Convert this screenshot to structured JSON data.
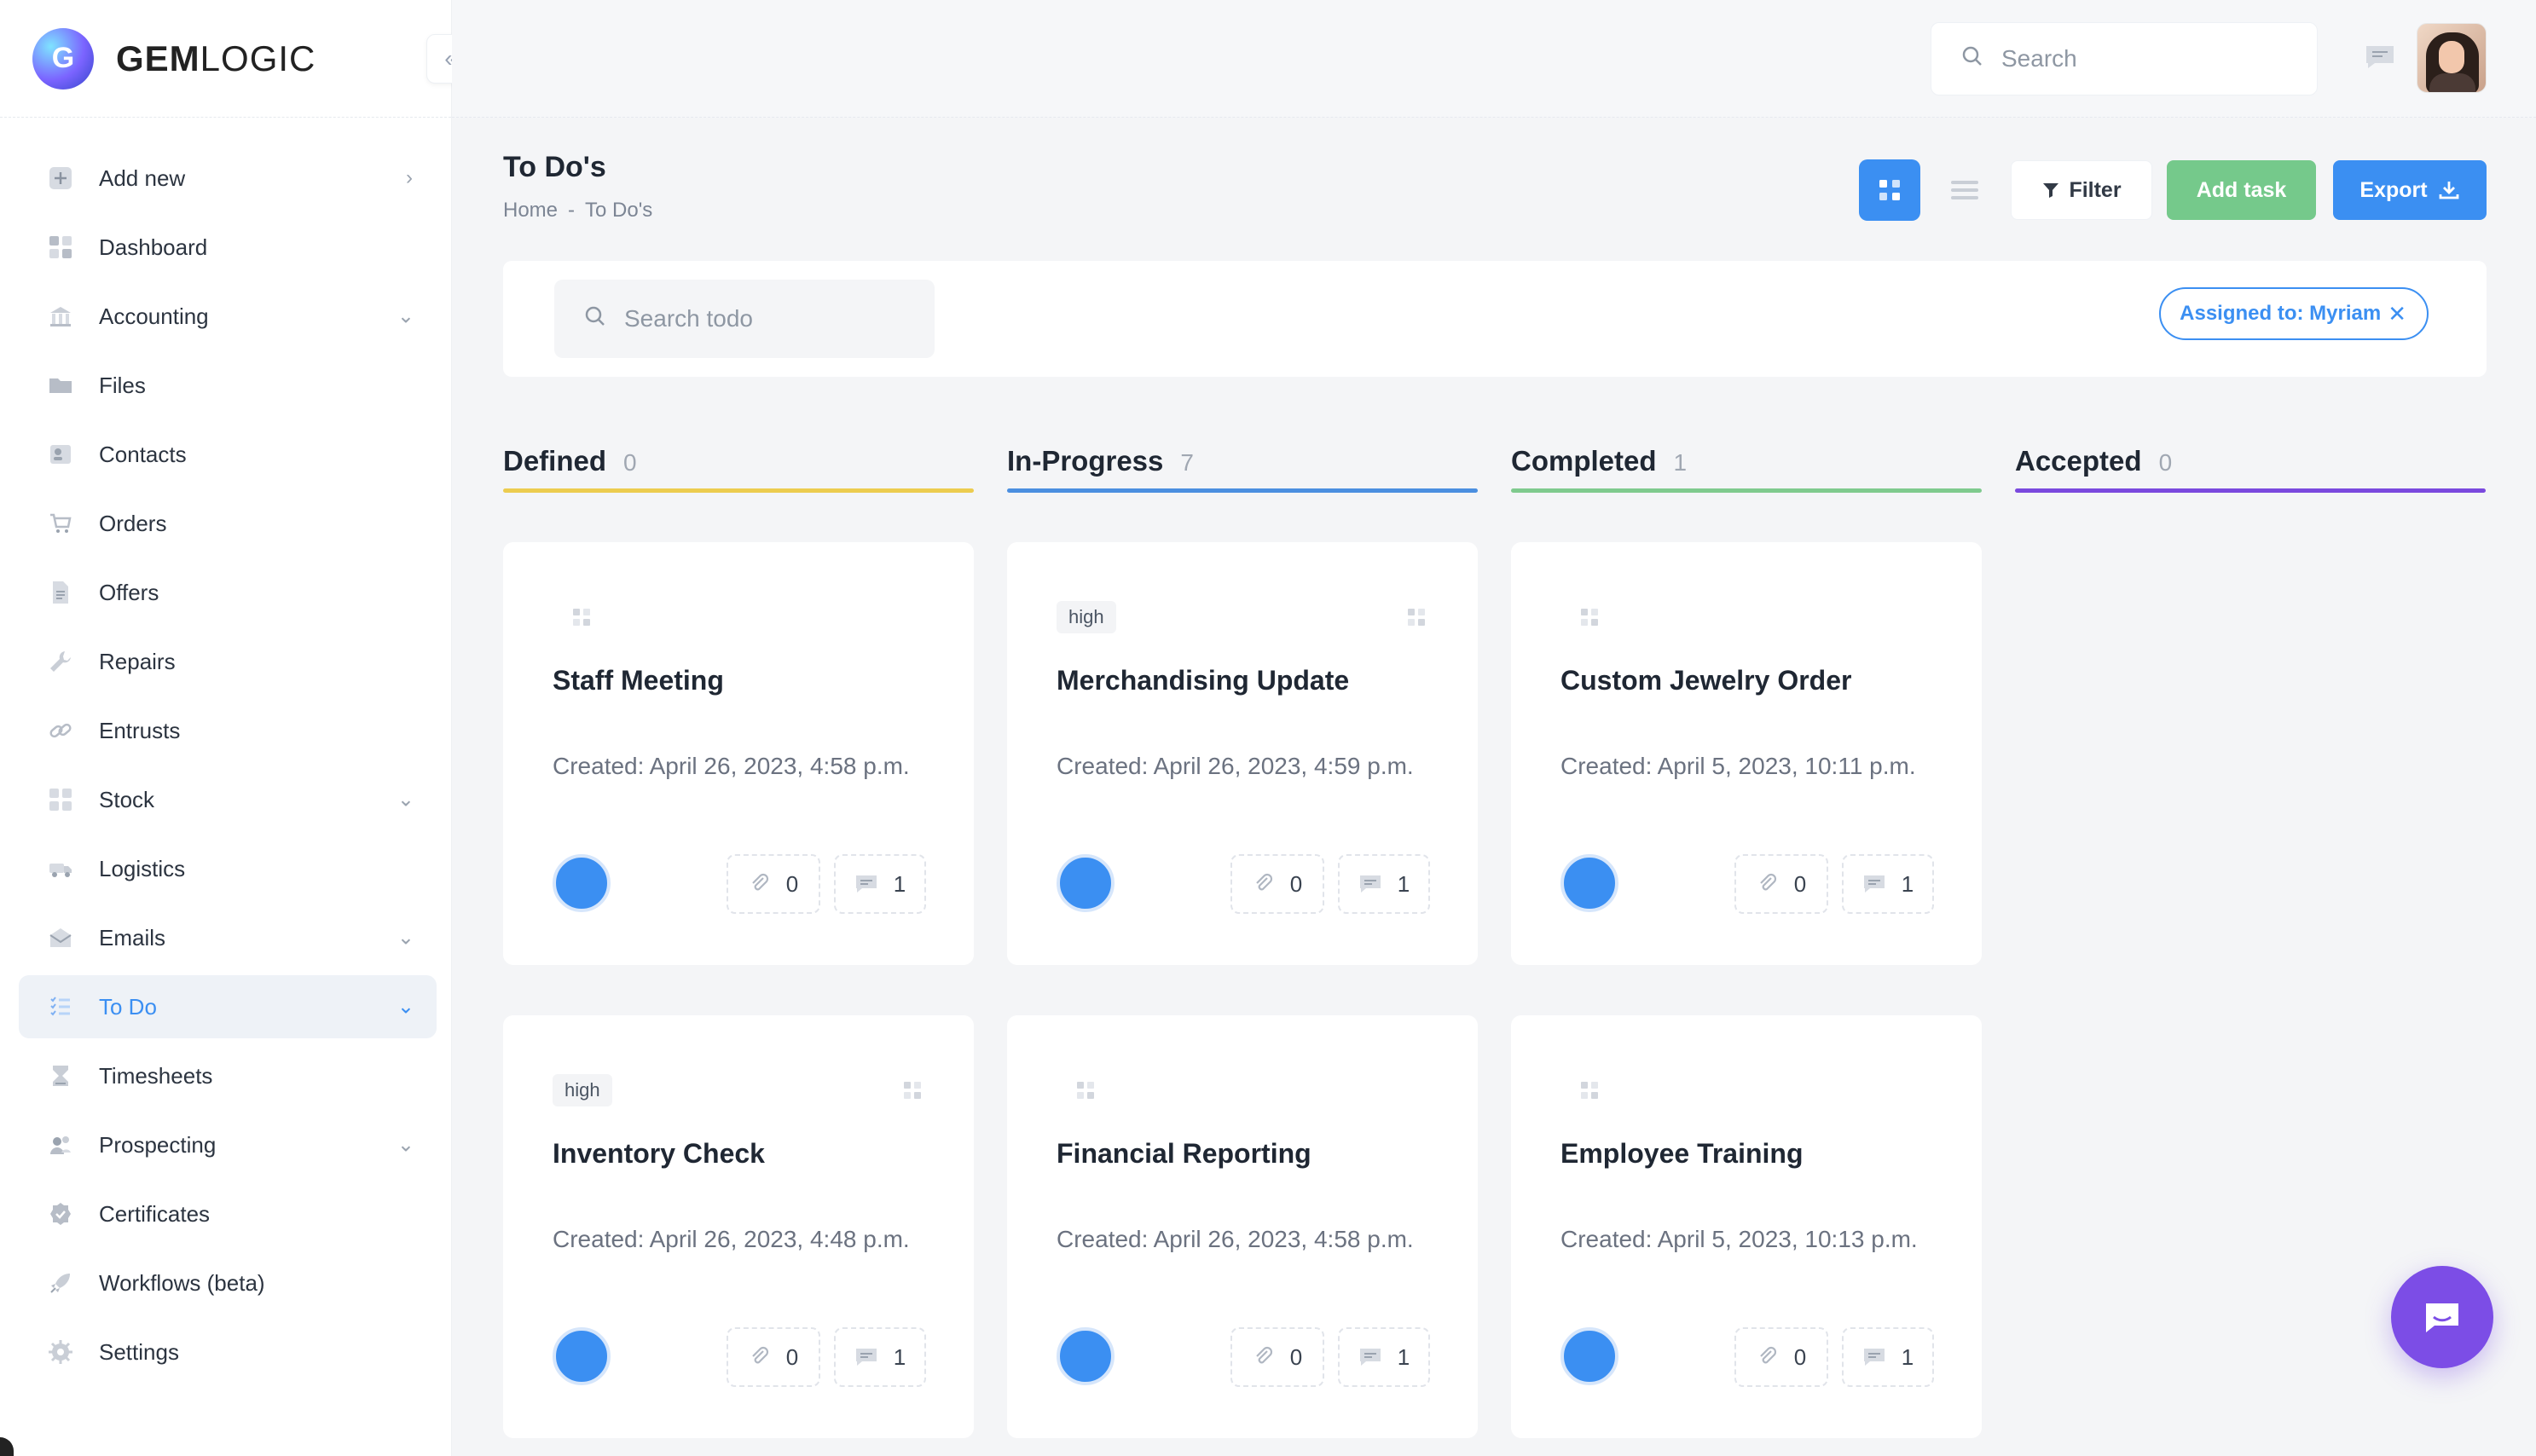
{
  "brand": {
    "name_bold": "GEM",
    "name_light": "LOGIC"
  },
  "topbar": {
    "search_placeholder": "Search"
  },
  "sidebar": {
    "items": [
      {
        "label": "Add new",
        "icon": "plus-square-icon",
        "chevron": "right"
      },
      {
        "label": "Dashboard",
        "icon": "grid-icon"
      },
      {
        "label": "Accounting",
        "icon": "bank-icon",
        "chevron": "down"
      },
      {
        "label": "Files",
        "icon": "folder-icon"
      },
      {
        "label": "Contacts",
        "icon": "contact-card-icon"
      },
      {
        "label": "Orders",
        "icon": "cart-icon"
      },
      {
        "label": "Offers",
        "icon": "document-icon"
      },
      {
        "label": "Repairs",
        "icon": "wrench-icon"
      },
      {
        "label": "Entrusts",
        "icon": "link-icon"
      },
      {
        "label": "Stock",
        "icon": "boxes-icon",
        "chevron": "down"
      },
      {
        "label": "Logistics",
        "icon": "truck-icon"
      },
      {
        "label": "Emails",
        "icon": "mail-icon",
        "chevron": "down"
      },
      {
        "label": "To Do",
        "icon": "checklist-icon",
        "chevron": "down",
        "active": true
      },
      {
        "label": "Timesheets",
        "icon": "hourglass-icon"
      },
      {
        "label": "Prospecting",
        "icon": "people-icon",
        "chevron": "down"
      },
      {
        "label": "Certificates",
        "icon": "badge-icon"
      },
      {
        "label": "Workflows (beta)",
        "icon": "rocket-icon"
      },
      {
        "label": "Settings",
        "icon": "gear-icon"
      }
    ]
  },
  "page": {
    "title": "To Do's",
    "breadcrumb": {
      "home": "Home",
      "sep": "-",
      "current": "To Do's"
    },
    "buttons": {
      "filter": "Filter",
      "add": "Add task",
      "export": "Export"
    },
    "search_placeholder": "Search todo",
    "chip": {
      "label": "Assigned to: Myriam",
      "close": "✕"
    }
  },
  "columns": [
    {
      "name": "Defined",
      "count": "0",
      "color": "#eccc4f"
    },
    {
      "name": "In-Progress",
      "count": "7",
      "color": "#4b8fe0"
    },
    {
      "name": "Completed",
      "count": "1",
      "color": "#7fca8e"
    },
    {
      "name": "Accepted",
      "count": "0",
      "color": "#7a49de"
    }
  ],
  "cards": [
    {
      "title": "Staff Meeting",
      "tag": "",
      "created": "Created: April 26, 2023, 4:58 p.m.",
      "attachments": "0",
      "comments": "1"
    },
    {
      "title": "Merchandising Update",
      "tag": "high",
      "created": "Created: April 26, 2023, 4:59 p.m.",
      "attachments": "0",
      "comments": "1"
    },
    {
      "title": "Custom Jewelry Order",
      "tag": "",
      "created": "Created: April 5, 2023, 10:11 p.m.",
      "attachments": "0",
      "comments": "1"
    },
    {
      "title": "Inventory Check",
      "tag": "high",
      "created": "Created: April 26, 2023, 4:48 p.m.",
      "attachments": "0",
      "comments": "1"
    },
    {
      "title": "Financial Reporting",
      "tag": "",
      "created": "Created: April 26, 2023, 4:58 p.m.",
      "attachments": "0",
      "comments": "1"
    },
    {
      "title": "Employee Training",
      "tag": "",
      "created": "Created: April 5, 2023, 10:13 p.m.",
      "attachments": "0",
      "comments": "1"
    }
  ]
}
